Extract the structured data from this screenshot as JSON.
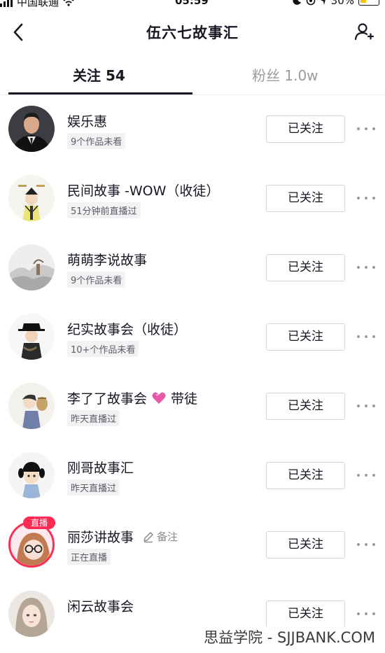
{
  "status_bar": {
    "carrier": "中国联通",
    "time": "05:59",
    "battery": "30%"
  },
  "header": {
    "title": "伍六七故事汇",
    "back_icon": "chevron-left-icon",
    "add_friend_icon": "add-user-icon"
  },
  "tabs": [
    {
      "label": "关注 54",
      "active": true
    },
    {
      "label": "粉丝 1.0w",
      "active": false
    }
  ],
  "colors": {
    "text": "#161823",
    "muted": "#9a9aa0",
    "live": "#fe2c55",
    "tag_bg": "#f2f2f4"
  },
  "follow_label": "已关注",
  "list": [
    {
      "name": "娱乐惠",
      "sub": "9个作品未看",
      "live": false
    },
    {
      "name": "民间故事 -WOW（收徒）",
      "sub": "51分钟前直播过",
      "live": false
    },
    {
      "name": "萌萌李说故事",
      "sub": "9个作品未看",
      "live": false
    },
    {
      "name": "纪实故事会（收徒）",
      "sub": "10+个作品未看",
      "live": false
    },
    {
      "name": "李了了故事会",
      "name_suffix": "带徒",
      "sub": "昨天直播过",
      "live": false
    },
    {
      "name": "刚哥故事汇",
      "sub": "昨天直播过",
      "live": false
    },
    {
      "name": "丽莎讲故事",
      "remark": "备注",
      "sub": "正在直播",
      "live": true,
      "live_badge": "直播"
    },
    {
      "name": "闲云故事会",
      "sub": "",
      "live": false
    }
  ],
  "watermark": "思益学院 - SJJBANK.COM"
}
